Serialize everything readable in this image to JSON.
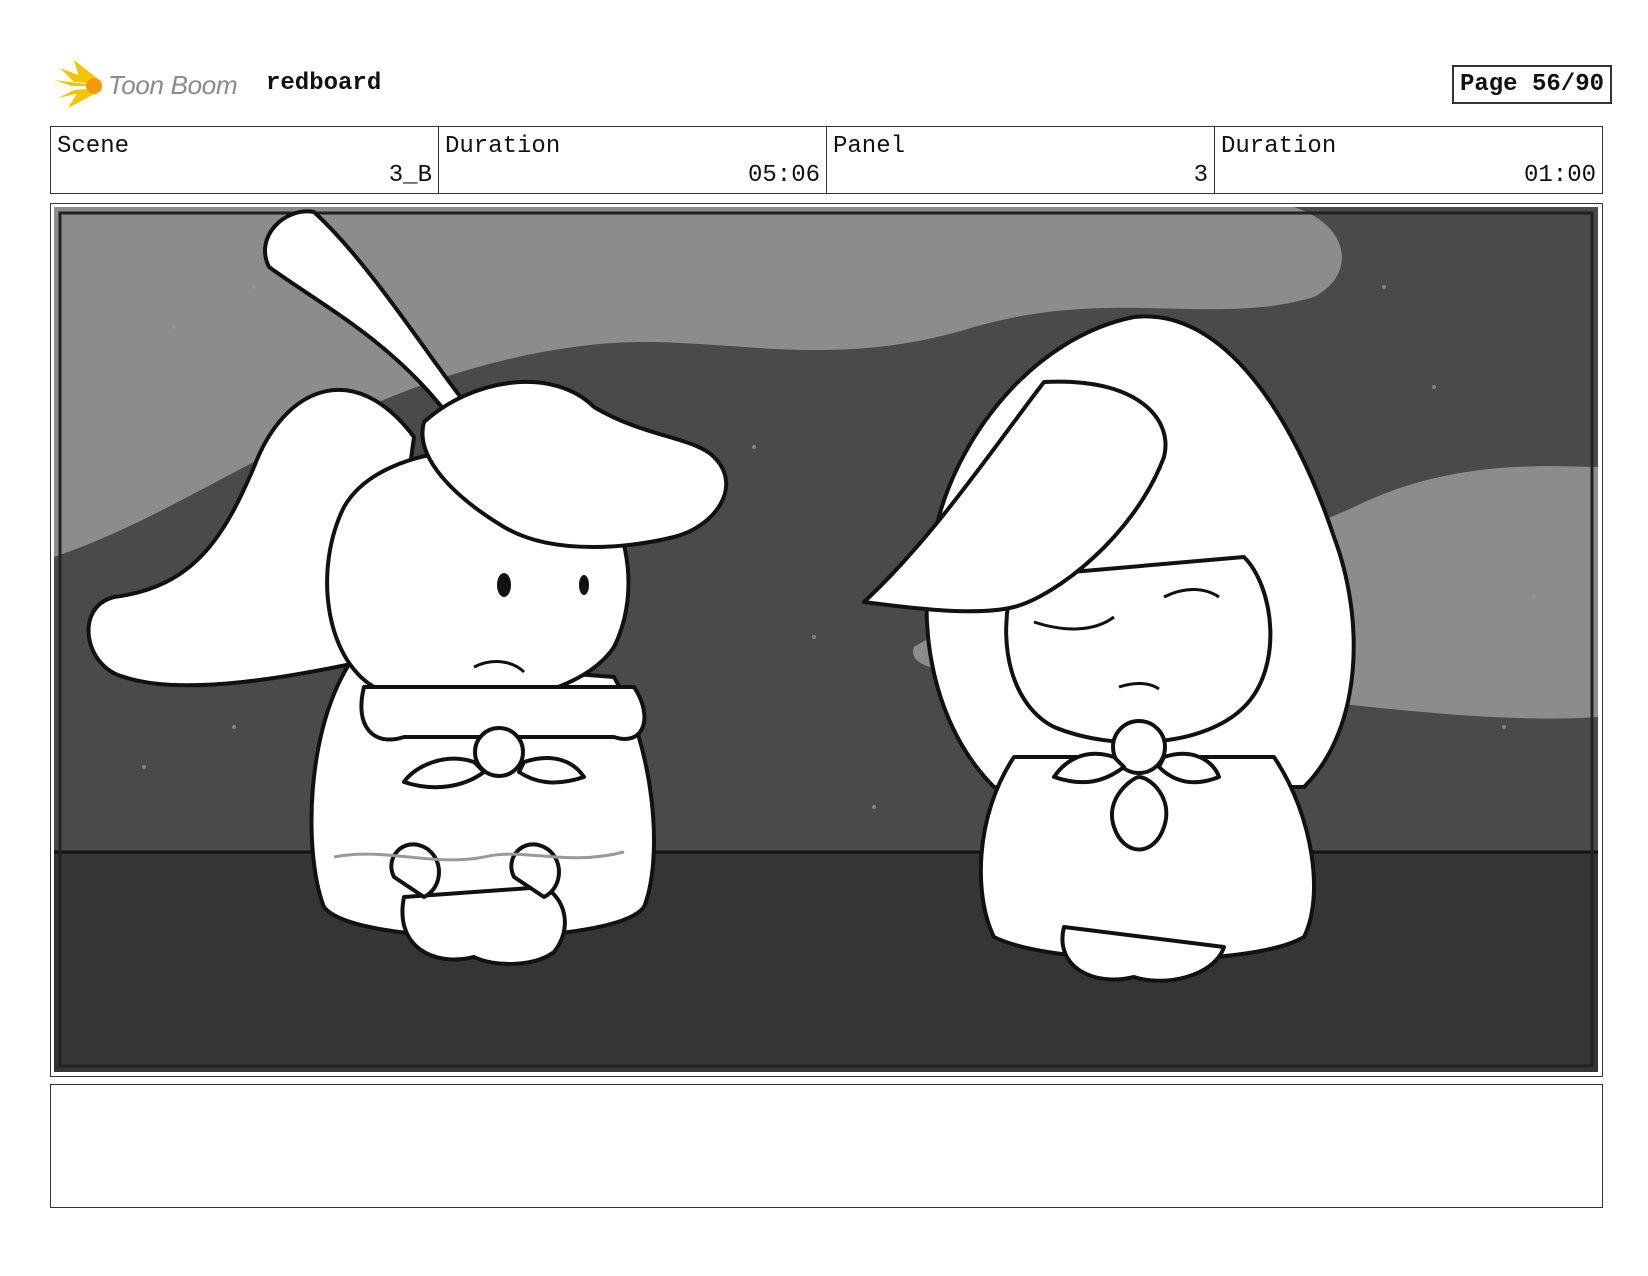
{
  "header": {
    "logo_text": "Toon Boom",
    "project_name": "redboard",
    "page_label": "Page 56/90"
  },
  "info": {
    "scene_label": "Scene",
    "scene_value": "3_B",
    "scene_duration_label": "Duration",
    "scene_duration_value": "05:06",
    "panel_label": "Panel",
    "panel_value": "3",
    "panel_duration_label": "Duration",
    "panel_duration_value": "01:00"
  },
  "notes": {
    "text": ""
  }
}
